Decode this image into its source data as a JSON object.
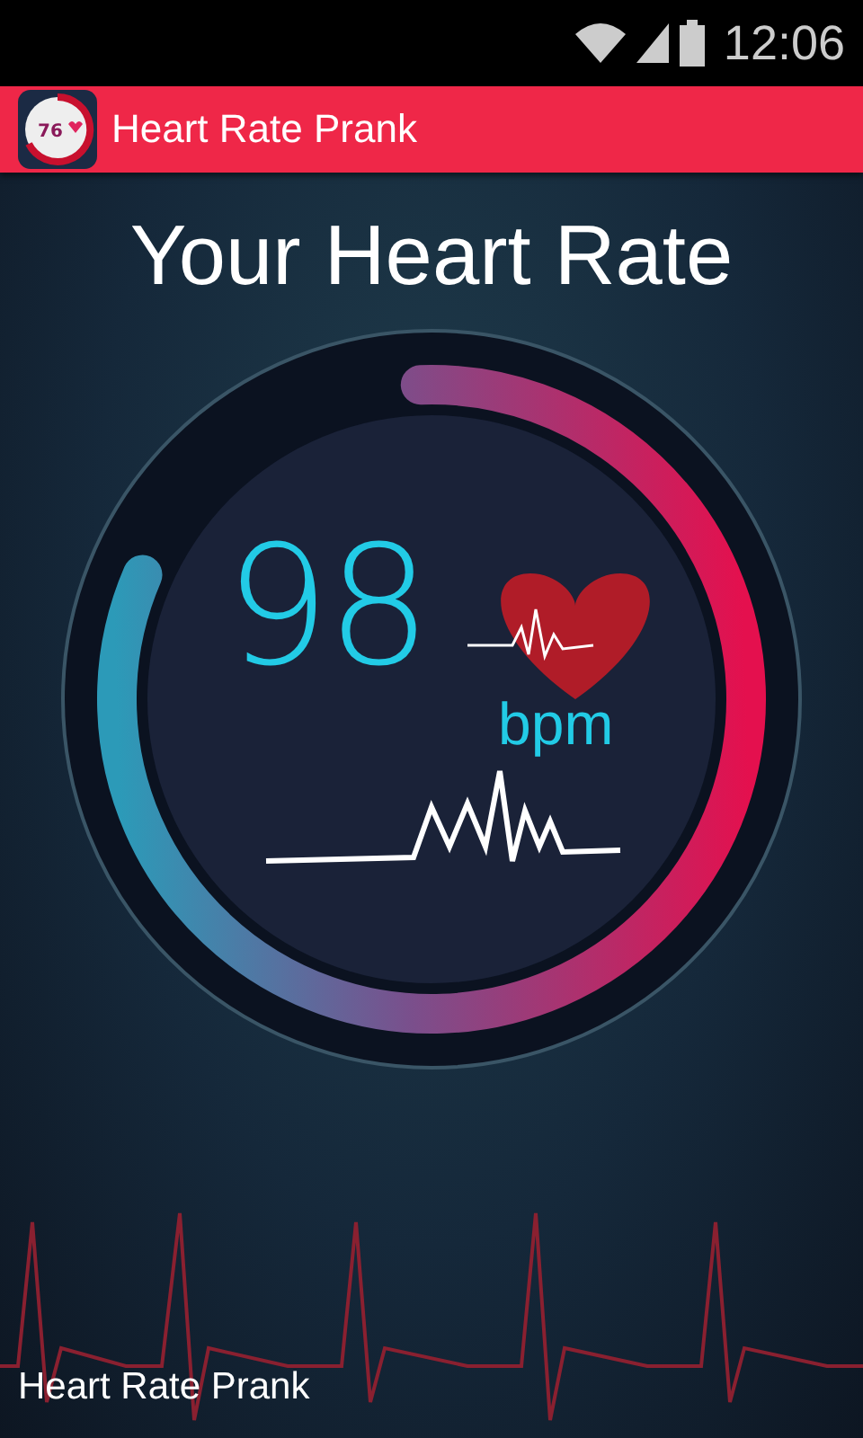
{
  "status_bar": {
    "time": "12:06"
  },
  "app_bar": {
    "logo_text": "76",
    "title": "Heart Rate Prank"
  },
  "heading": "Your Heart Rate",
  "gauge": {
    "level": 0.82,
    "value": "98",
    "unit": "bpm"
  },
  "footer": {
    "label": "Heart Rate Prank"
  }
}
